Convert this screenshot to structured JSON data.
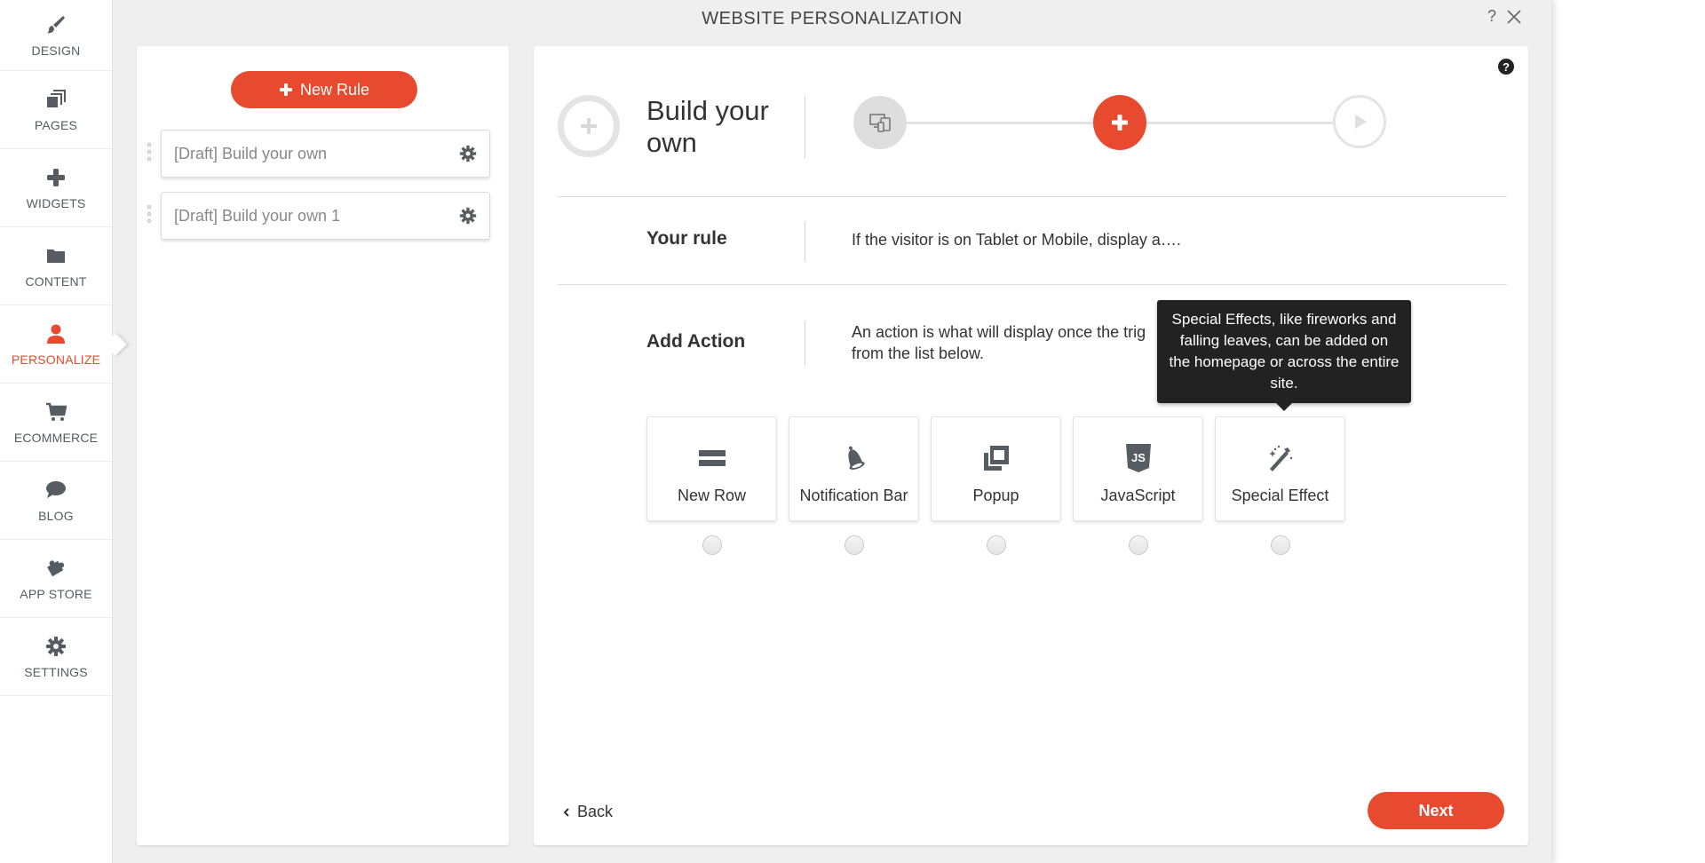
{
  "sidebar": {
    "items": [
      {
        "label": "DESIGN",
        "icon": "paintbrush-icon",
        "active": false
      },
      {
        "label": "PAGES",
        "icon": "pages-icon",
        "active": false
      },
      {
        "label": "WIDGETS",
        "icon": "plus-icon",
        "active": false
      },
      {
        "label": "CONTENT",
        "icon": "folder-icon",
        "active": false
      },
      {
        "label": "PERSONALIZE",
        "icon": "user-icon",
        "active": true
      },
      {
        "label": "ECOMMERCE",
        "icon": "cart-icon",
        "active": false
      },
      {
        "label": "BLOG",
        "icon": "speech-bubble-icon",
        "active": false
      },
      {
        "label": "APP STORE",
        "icon": "puzzle-icon",
        "active": false
      },
      {
        "label": "SETTINGS",
        "icon": "gear-icon",
        "active": false
      }
    ]
  },
  "modal": {
    "title": "WEBSITE PERSONALIZATION",
    "help_label": "?"
  },
  "rules": {
    "new_rule_label": "New Rule",
    "items": [
      {
        "label": "[Draft] Build your own"
      },
      {
        "label": "[Draft] Build your own 1"
      }
    ]
  },
  "main": {
    "help_label": "?",
    "header_title": "Build your own",
    "steps": [
      {
        "name": "trigger",
        "icon": "devices-icon",
        "state": "done"
      },
      {
        "name": "action",
        "icon": "plus-icon",
        "state": "current"
      },
      {
        "name": "publish",
        "icon": "play-icon",
        "state": "pending"
      }
    ],
    "your_rule_label": "Your rule",
    "your_rule_text": "If the visitor is on Tablet or Mobile, display a….",
    "add_action_label": "Add Action",
    "add_action_text_line1": "An action is what will display once the trig",
    "add_action_text_line2": "from the list below.",
    "actions": [
      {
        "label": "New Row",
        "icon": "rows-icon",
        "selected": false
      },
      {
        "label": "Notification Bar",
        "icon": "bell-icon",
        "selected": false
      },
      {
        "label": "Popup",
        "icon": "popup-icon",
        "selected": false
      },
      {
        "label": "JavaScript",
        "icon": "js-icon",
        "selected": false
      },
      {
        "label": "Special Effect",
        "icon": "magic-wand-icon",
        "selected": false
      }
    ],
    "tooltip": "Special Effects, like fireworks and falling leaves, can be added on the homepage or across the entire site.",
    "back_label": "Back",
    "next_label": "Next"
  },
  "colors": {
    "accent": "#e84a2f",
    "icon_gray": "#555d62",
    "tooltip_bg": "#222222"
  }
}
